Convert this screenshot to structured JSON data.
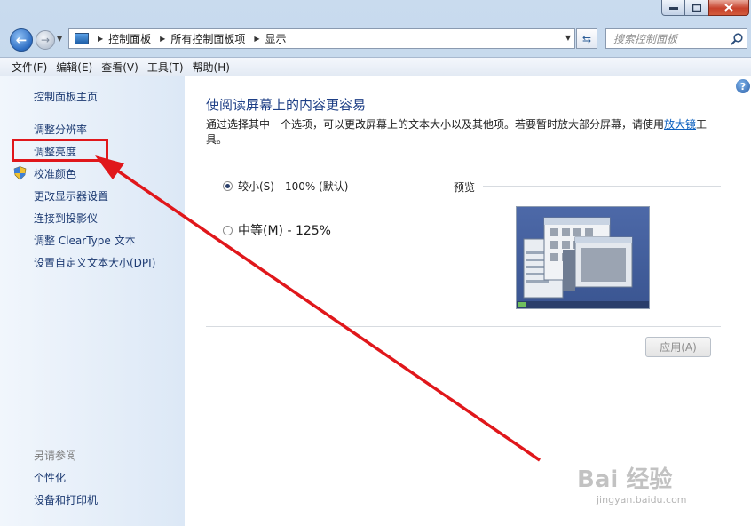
{
  "nav": {
    "back_symbol": "←",
    "forward_symbol": "→",
    "breadcrumbs": [
      "控制面板",
      "所有控制面板项",
      "显示"
    ],
    "search_placeholder": "搜索控制面板"
  },
  "menu": [
    "文件(F)",
    "编辑(E)",
    "查看(V)",
    "工具(T)",
    "帮助(H)"
  ],
  "sidebar": {
    "home": "控制面板主页",
    "items": [
      "调整分辨率",
      "调整亮度",
      "校准颜色",
      "更改显示器设置",
      "连接到投影仪",
      "调整 ClearType 文本",
      "设置自定义文本大小(DPI)"
    ],
    "see_also_title": "另请参阅",
    "see_also": [
      "个性化",
      "设备和打印机"
    ]
  },
  "main": {
    "heading": "使阅读屏幕上的内容更容易",
    "description_prefix": "通过选择其中一个选项，可以更改屏幕上的文本大小以及其他项。若要暂时放大部分屏幕，请使用",
    "description_link": "放大镜",
    "description_suffix": "工具。",
    "options": [
      {
        "label": "较小(S) - 100% (默认)",
        "selected": true
      },
      {
        "label": "中等(M) - 125%",
        "selected": false
      }
    ],
    "preview_label": "预览",
    "apply_label": "应用(A)"
  },
  "watermark": {
    "brand": "Bai 经验",
    "site": "jingyan.baidu.com"
  },
  "colors": {
    "annotation": "#e0171b",
    "link": "#1c3a72",
    "heading": "#1e3f86"
  }
}
